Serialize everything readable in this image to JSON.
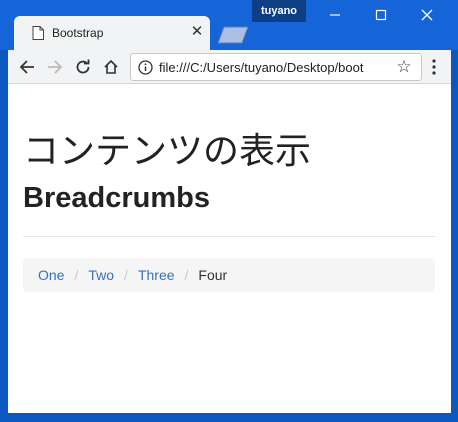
{
  "browser": {
    "tab_title": "Bootstrap",
    "tab_close": "✕",
    "user": "tuyano",
    "url": "file:///C:/Users/tuyano/Desktop/boot",
    "icons": [
      "page-icon",
      "back-arrow-icon",
      "forward-arrow-icon",
      "reload-icon",
      "home-icon",
      "info-icon",
      "star-icon",
      "menu-dots-icon",
      "minimize-icon",
      "maximize-icon",
      "close-icon"
    ]
  },
  "page": {
    "heading": "コンテンツの表示",
    "subheading": "Breadcrumbs",
    "breadcrumb": {
      "items": [
        "One",
        "Two",
        "Three"
      ],
      "separator": "/",
      "active": "Four"
    }
  },
  "colors": {
    "titlebar": "#1565d8",
    "link": "#3771b6",
    "breadcrumb_bg": "#f5f5f5"
  }
}
